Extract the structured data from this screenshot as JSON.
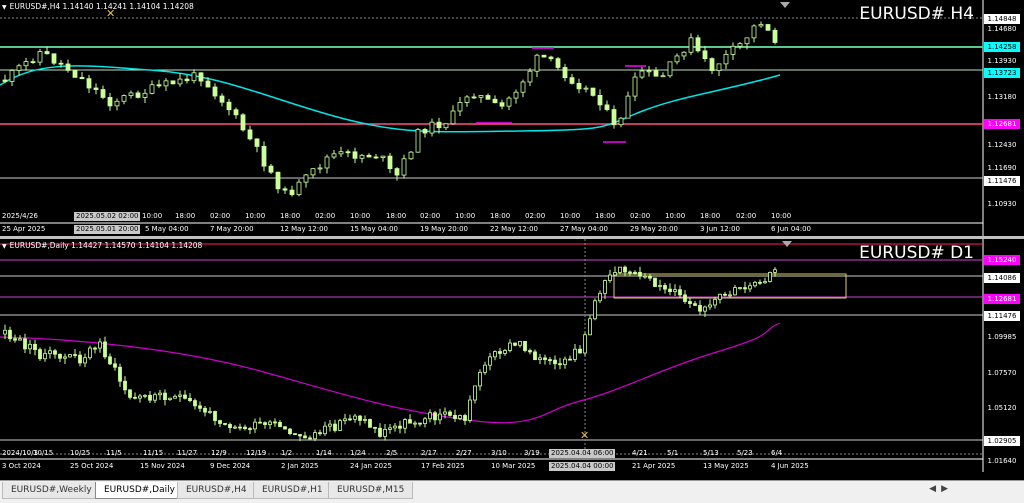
{
  "h4": {
    "header": "EURUSD#,H4  1.14140 1.14241 1.14104 1.14208",
    "title": "EURUSD# H4",
    "price_labels": [
      {
        "value": "1.14848",
        "bg": "#ffffff",
        "fg": "#000000"
      },
      {
        "value": "1.14680",
        "bg": "",
        "fg": "#ffffff"
      },
      {
        "value": "1.14258",
        "bg": "#00ffff",
        "fg": "#000000"
      },
      {
        "value": "1.13930",
        "bg": "",
        "fg": "#ffffff"
      },
      {
        "value": "1.13723",
        "bg": "#00ffff",
        "fg": "#000000"
      },
      {
        "value": "1.13180",
        "bg": "",
        "fg": "#ffffff"
      },
      {
        "value": "1.12681",
        "bg": "#ff00ff",
        "fg": "#ffffff"
      },
      {
        "value": "1.12430",
        "bg": "",
        "fg": "#ffffff"
      },
      {
        "value": "1.11690",
        "bg": "",
        "fg": "#ffffff"
      },
      {
        "value": "1.11476",
        "bg": "#ffffff",
        "fg": "#000000"
      },
      {
        "value": "1.10930",
        "bg": "",
        "fg": "#ffffff"
      }
    ],
    "time_row1": [
      "2025/4/26",
      "10:00",
      "18:00",
      "02:00",
      "10:00",
      "18:00",
      "02:00",
      "10:00",
      "18:00",
      "02:00",
      "10:00",
      "18:00",
      "02:00",
      "10:00",
      "18:00",
      "02:00",
      "10:00",
      "18:00",
      "02:00",
      "10:00"
    ],
    "time_row1_box1": "2025.05.02 02:00",
    "time_row2": [
      "25 Apr 2025",
      "5 May 04:00",
      "7 May 20:00",
      "12 May 12:00",
      "15 May 04:00",
      "19 May 20:00",
      "22 May 12:00",
      "27 May 04:00",
      "29 May 20:00",
      "3 Jun 12:00",
      "6 Jun 04:00"
    ],
    "time_row2_box1": "2025.05.01 20:00"
  },
  "d1": {
    "header": "EURUSD#,Daily  1.14427 1.14570 1.14104 1.14208",
    "title": "EURUSD# D1",
    "price_labels": [
      {
        "value": "1.15240",
        "bg": "#ff00ff",
        "fg": "#ffffff"
      },
      {
        "value": "1.14086",
        "bg": "#ffffff",
        "fg": "#000000"
      },
      {
        "value": "1.12681",
        "bg": "#ff00ff",
        "fg": "#ffffff"
      },
      {
        "value": "1.11476",
        "bg": "#ffffff",
        "fg": "#000000"
      },
      {
        "value": "1.09985",
        "bg": "",
        "fg": "#ffffff"
      },
      {
        "value": "1.07570",
        "bg": "",
        "fg": "#ffffff"
      },
      {
        "value": "1.05120",
        "bg": "",
        "fg": "#ffffff"
      },
      {
        "value": "1.02905",
        "bg": "#ffffff",
        "fg": "#000000"
      },
      {
        "value": "1.01640",
        "bg": "",
        "fg": "#ffffff"
      }
    ],
    "time_row1": [
      "2024/10/3",
      "10/15",
      "10/25",
      "11/5",
      "11/15",
      "11/27",
      "12/9",
      "12/19",
      "1/2",
      "1/14",
      "1/24",
      "2/5",
      "2/17",
      "2/27",
      "3/10",
      "3/19",
      "4/21",
      "5/1",
      "5/13",
      "5/23",
      "6/4"
    ],
    "time_row1_box1": "2025.04.04 06:00",
    "time_row2": [
      "3 Oct 2024",
      "25 Oct 2024",
      "15 Nov 2024",
      "9 Dec 2024",
      "2 Jan 2025",
      "24 Jan 2025",
      "17 Feb 2025",
      "10 Mar 2025",
      "21 Apr 2025",
      "13 May 2025",
      "4 Jun 2025"
    ],
    "time_row2_box1": "2025.04.04 00:00"
  },
  "tabs": [
    {
      "label": "EURUSD#,Weekly",
      "active": false
    },
    {
      "label": "EURUSD#,Daily",
      "active": true
    },
    {
      "label": "EURUSD#,H4",
      "active": false
    },
    {
      "label": "EURUSD#,H1",
      "active": false
    },
    {
      "label": "EURUSD#,M15",
      "active": false
    }
  ],
  "colors": {
    "candle": "#ccff99",
    "ma_h4": "#00e5e5",
    "ma_d1": "#cc00cc",
    "support_line": "#ff5080",
    "box": "#e0d060"
  }
}
